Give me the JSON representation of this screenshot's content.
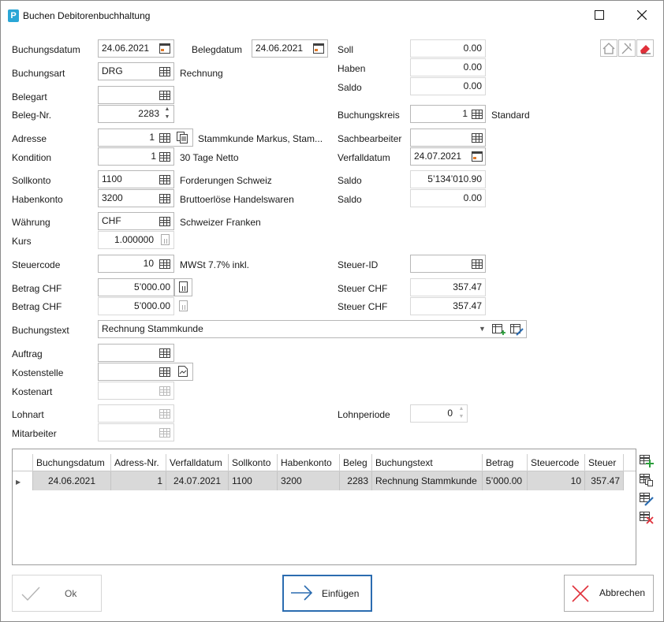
{
  "window": {
    "title": "Buchen Debitorenbuchhaltung",
    "app_icon": "P"
  },
  "form": {
    "buchungsdatum": {
      "label": "Buchungsdatum",
      "value": "24.06.2021"
    },
    "belegdatum": {
      "label": "Belegdatum",
      "value": "24.06.2021"
    },
    "soll": {
      "label": "Soll",
      "value": "0.00"
    },
    "haben": {
      "label": "Haben",
      "value": "0.00"
    },
    "saldo_top": {
      "label": "Saldo",
      "value": "0.00"
    },
    "buchungsart": {
      "label": "Buchungsart",
      "value": "DRG",
      "desc": "Rechnung"
    },
    "belegart": {
      "label": "Belegart",
      "value": ""
    },
    "belegnr": {
      "label": "Beleg-Nr.",
      "value": "2283"
    },
    "buchungskreis": {
      "label": "Buchungskreis",
      "value": "1",
      "desc": "Standard"
    },
    "adresse": {
      "label": "Adresse",
      "value": "1",
      "desc": "Stammkunde Markus, Stam..."
    },
    "sachbearbeiter": {
      "label": "Sachbearbeiter",
      "value": ""
    },
    "kondition": {
      "label": "Kondition",
      "value": "1",
      "desc": "30 Tage Netto"
    },
    "verfalldatum": {
      "label": "Verfalldatum",
      "value": "24.07.2021"
    },
    "sollkonto": {
      "label": "Sollkonto",
      "value": "1100",
      "desc": "Forderungen Schweiz"
    },
    "saldo_soll": {
      "label": "Saldo",
      "value": "5’134’010.90"
    },
    "habenkonto": {
      "label": "Habenkonto",
      "value": "3200",
      "desc": "Bruttoerlöse Handelswaren"
    },
    "saldo_haben": {
      "label": "Saldo",
      "value": "0.00"
    },
    "waehrung": {
      "label": "Währung",
      "value": "CHF",
      "desc": "Schweizer Franken"
    },
    "kurs": {
      "label": "Kurs",
      "value": "1.000000"
    },
    "steuercode": {
      "label": "Steuercode",
      "value": "10",
      "desc": "MWSt 7.7% inkl."
    },
    "steuer_id": {
      "label": "Steuer-ID",
      "value": ""
    },
    "betrag_chf_1": {
      "label": "Betrag CHF",
      "value": "5’000.00"
    },
    "steuer_chf_1": {
      "label": "Steuer CHF",
      "value": "357.47"
    },
    "betrag_chf_2": {
      "label": "Betrag CHF",
      "value": "5’000.00"
    },
    "steuer_chf_2": {
      "label": "Steuer CHF",
      "value": "357.47"
    },
    "buchungstext": {
      "label": "Buchungstext",
      "value": "Rechnung Stammkunde"
    },
    "auftrag": {
      "label": "Auftrag",
      "value": ""
    },
    "kostenstelle": {
      "label": "Kostenstelle",
      "value": ""
    },
    "kostenart": {
      "label": "Kostenart",
      "value": ""
    },
    "lohnart": {
      "label": "Lohnart",
      "value": ""
    },
    "lohnperiode": {
      "label": "Lohnperiode",
      "value": "0"
    },
    "mitarbeiter": {
      "label": "Mitarbeiter",
      "value": ""
    }
  },
  "table": {
    "columns": [
      "Buchungsdatum",
      "Adress-Nr.",
      "Verfalldatum",
      "Sollkonto",
      "Habenkonto",
      "Beleg",
      "Buchungstext",
      "Betrag",
      "Steuercode",
      "Steuer"
    ],
    "rows": [
      [
        "24.06.2021",
        "1",
        "24.07.2021",
        "1100",
        "3200",
        "2283",
        "Rechnung Stammkunde",
        "5’000.00",
        "10",
        "357.47"
      ]
    ]
  },
  "buttons": {
    "ok": "Ok",
    "einfuegen": "Einfügen",
    "abbrechen": "Abbrechen"
  },
  "colors": {
    "accent": "#2b6cb0",
    "eraser": "#e0303a",
    "cancel_x": "#e0303a",
    "selected_row": "#d9d9d9"
  }
}
